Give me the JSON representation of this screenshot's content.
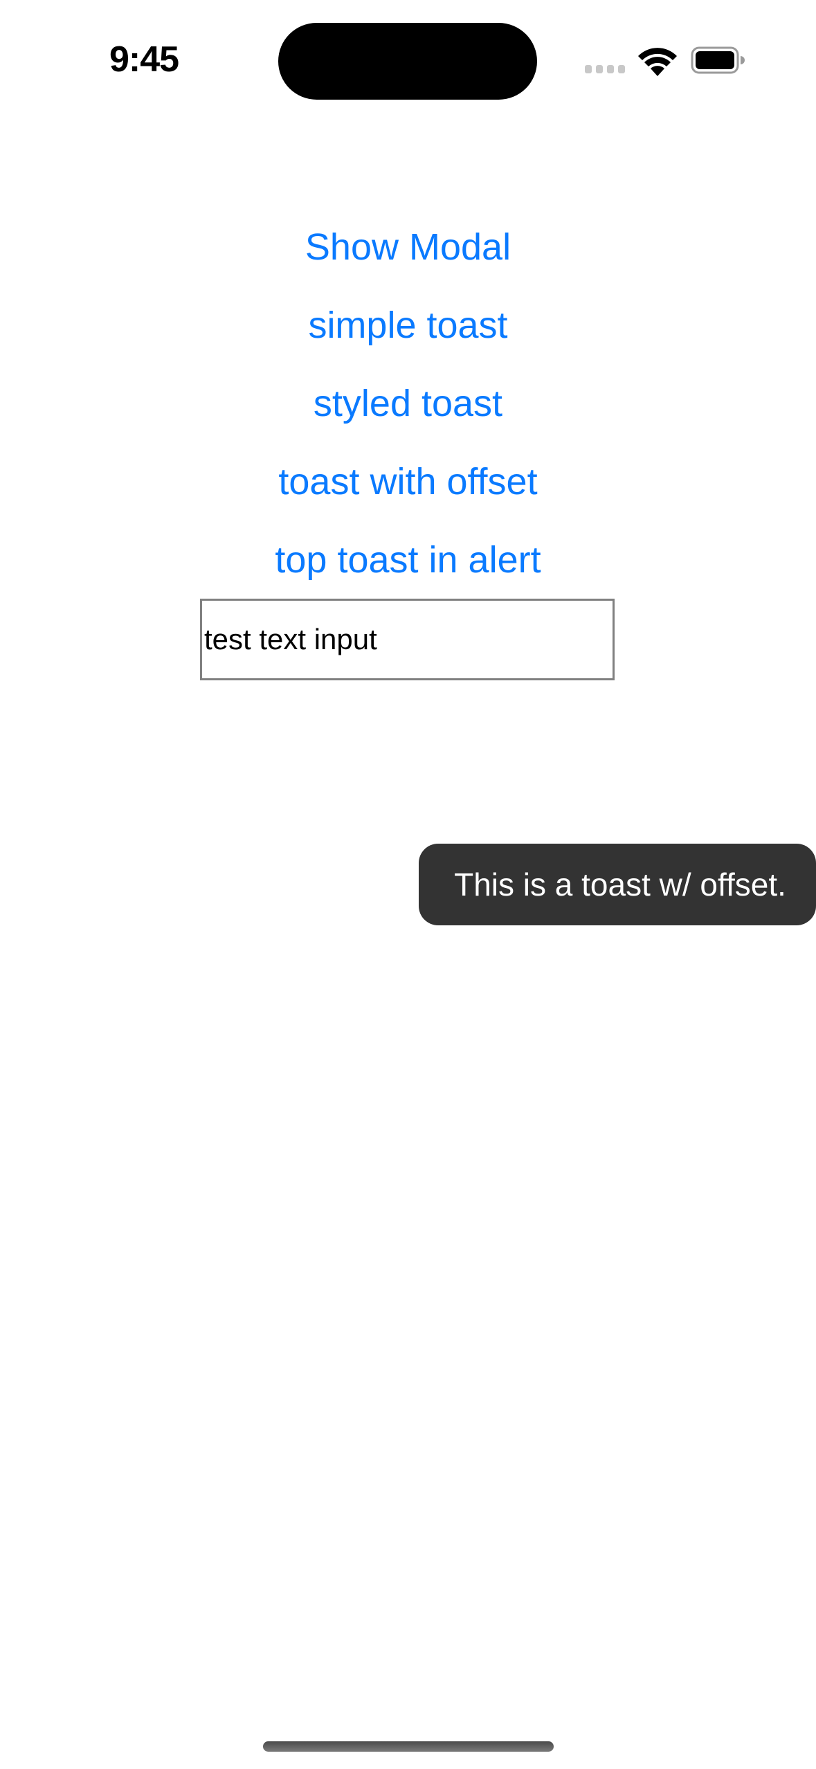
{
  "status_bar": {
    "time": "9:45",
    "icons": [
      "cellular-signal-icon",
      "wifi-icon",
      "battery-icon"
    ]
  },
  "buttons": [
    {
      "label": "Show Modal"
    },
    {
      "label": "simple toast"
    },
    {
      "label": "styled toast"
    },
    {
      "label": "toast with offset"
    },
    {
      "label": "top toast in alert"
    }
  ],
  "text_input": {
    "value": "test text input"
  },
  "toast": {
    "message": "This is a toast w/ offset."
  },
  "colors": {
    "accent": "#0a7aff",
    "toast_background": "#333333",
    "toast_text": "#ffffff",
    "input_border": "#808080"
  }
}
